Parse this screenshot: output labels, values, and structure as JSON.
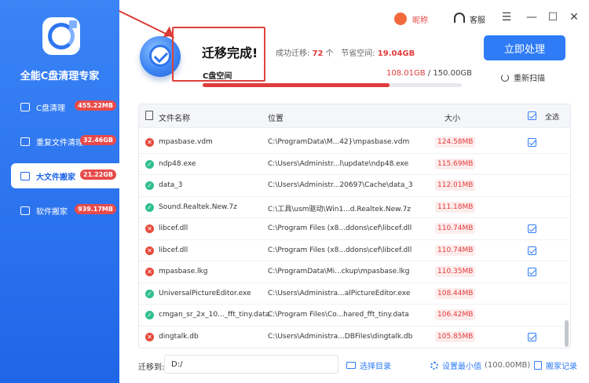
{
  "app": {
    "title": "全能C盘清理专家"
  },
  "sidebar": {
    "items": [
      {
        "label": "C盘清理",
        "badge": "455.22MB",
        "active": false
      },
      {
        "label": "重复文件清理",
        "badge": "32.46GB",
        "active": false
      },
      {
        "label": "大文件搬家",
        "badge": "21.22GB",
        "active": true
      },
      {
        "label": "软件搬家",
        "badge": "939.17MB",
        "active": false
      }
    ]
  },
  "topbar": {
    "nickname": "昵称",
    "service": "客服",
    "menu_icon": "☰",
    "minimize_icon": "—",
    "maximize_icon": "☐",
    "close_icon": "✕"
  },
  "result": {
    "title": "迁移完成!",
    "success_label": "成功迁移:",
    "success_count": "72",
    "success_unit": "个",
    "saved_label": "节省空间:",
    "saved_value": "19.04GB",
    "disk_label": "C盘空间",
    "disk_used": "108.01GB",
    "disk_total": " / 150.00GB",
    "disk_used_fraction": 0.72
  },
  "actions": {
    "process": "立即处理",
    "rescan": "重新扫描"
  },
  "table": {
    "headers": {
      "name": "文件名称",
      "location": "位置",
      "size": "大小",
      "select_all": "全选"
    },
    "rows": [
      {
        "status": "fail",
        "name": "mpasbase.vdm",
        "path": "C:\\ProgramData\\M...42}\\mpasbase.vdm",
        "size": "124.58MB",
        "checked": true
      },
      {
        "status": "ok",
        "name": "ndp48.exe",
        "path": "C:\\Users\\Administr...l\\update\\ndp48.exe",
        "size": "115.69MB",
        "checked": false
      },
      {
        "status": "ok",
        "name": "data_3",
        "path": "C:\\Users\\Administr...20697\\Cache\\data_3",
        "size": "112.01MB",
        "checked": false
      },
      {
        "status": "ok",
        "name": "Sound.Realtek.New.7z",
        "path": "C:\\工具\\usm驱动\\Win1...d.Realtek.New.7z",
        "size": "111.18MB",
        "checked": false
      },
      {
        "status": "fail",
        "name": "libcef.dll",
        "path": "C:\\Program Files (x8...ddons\\cef\\libcef.dll",
        "size": "110.74MB",
        "checked": true
      },
      {
        "status": "fail",
        "name": "libcef.dll",
        "path": "C:\\Program Files (x8...ddons\\cef\\libcef.dll",
        "size": "110.74MB",
        "checked": true
      },
      {
        "status": "fail",
        "name": "mpasbase.lkg",
        "path": "C:\\ProgramData\\Mi...ckup\\mpasbase.lkg",
        "size": "110.35MB",
        "checked": true
      },
      {
        "status": "ok",
        "name": "UniversalPictureEditor.exe",
        "path": "C:\\Users\\Administra...alPictureEditor.exe",
        "size": "108.44MB",
        "checked": false
      },
      {
        "status": "ok",
        "name": "cmgan_sr_2x_10..._fft_tiny.data",
        "path": "C:\\Program Files\\Co...hared_fft_tiny.data",
        "size": "106.42MB",
        "checked": false
      },
      {
        "status": "fail",
        "name": "dingtalk.db",
        "path": "C:\\Users\\Administra...DBFiles\\dingtalk.db",
        "size": "105.85MB",
        "checked": true
      }
    ]
  },
  "footer": {
    "target_label": "迁移到:",
    "target_value": "D:/",
    "choose_dir": "选择目录",
    "set_min": "设置最小值",
    "min_value": "(100.00MB)",
    "history": "搬家记录"
  }
}
